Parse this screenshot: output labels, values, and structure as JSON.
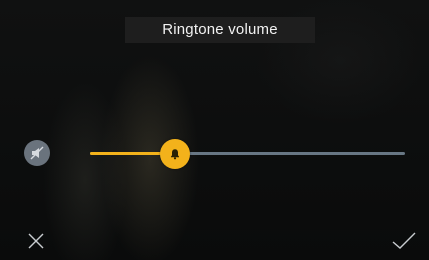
{
  "header": {
    "title": "Ringtone volume"
  },
  "volume": {
    "level": 0.27
  },
  "icons": {
    "mute": "speaker-muted-icon",
    "thumb": "bell-icon",
    "cancel": "close-icon",
    "confirm": "checkmark-icon"
  },
  "colors": {
    "accent": "#f3b21b",
    "track": "#687784",
    "mute_button": "#6a737d"
  }
}
